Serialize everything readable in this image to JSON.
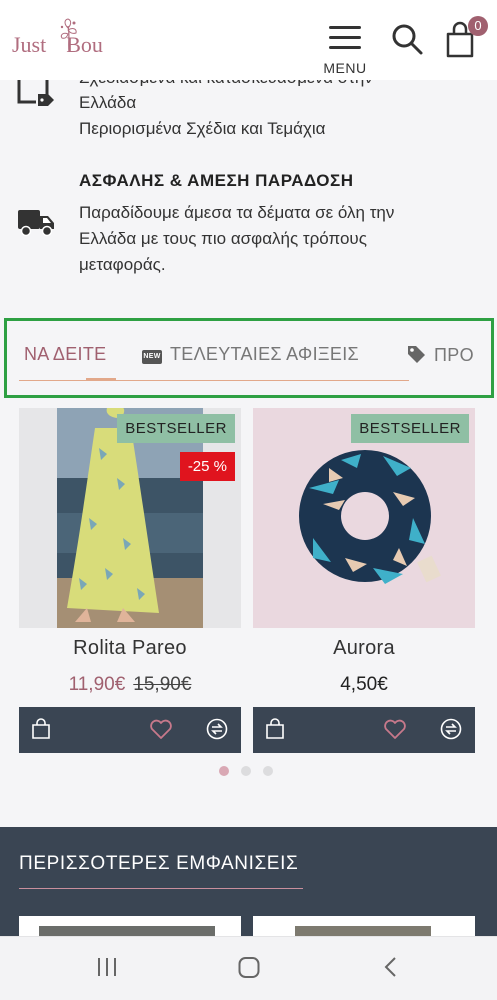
{
  "header": {
    "logo_left": "Just",
    "logo_right": "Bou",
    "menu_label": "MENU",
    "cart_count": "0"
  },
  "features": {
    "handmade": {
      "line1": "Σχεδιασμένα και κατασκευασμένα στην",
      "line2": "Ελλάδα",
      "line3": "Περιορισμένα Σχέδια και Τεμάχια"
    },
    "delivery": {
      "title": "ΑΣΦΑΛΗΣ & ΑΜΕΣΗ ΠΑΡΑΔΟΣΗ",
      "line1": "Παραδίδουμε άμεσα τα δέματα σε όλη την",
      "line2": "Ελλάδα με τους πιο ασφαλής τρόπους",
      "line3": "μεταφοράς."
    }
  },
  "tabs": [
    {
      "label": "ΝΑ ΔΕΙΤΕ",
      "active": true
    },
    {
      "label": "ΤΕΛΕΥΤΑΙΕΣ ΑΦΙΞΕΙΣ",
      "icon": "new-badge-icon",
      "active": false
    },
    {
      "label": "ΠΡΟ",
      "icon": "tag-icon",
      "active": false
    }
  ],
  "new_badge_text": "NEW",
  "products": [
    {
      "name": "Rolita Pareo",
      "price": "11,90€",
      "old_price": "15,90€",
      "badge": "BESTSELLER",
      "discount": "-25 %"
    },
    {
      "name": "Aurora",
      "price": "4,50€",
      "badge": "BESTSELLER"
    }
  ],
  "carousel": {
    "pages": 3,
    "active_page": 1
  },
  "more_section": {
    "title": "ΠΕΡΙΣΣΟΤΕΡΕΣ ΕΜΦΑΝΙΣΕΙΣ"
  },
  "colors": {
    "brand": "#b06d7f",
    "accent_line": "#e2a88a",
    "badge_bestseller": "#8fbfa4",
    "badge_sale": "#e0141e",
    "action_bar": "#3a4553",
    "highlight_box": "#2ea043"
  }
}
